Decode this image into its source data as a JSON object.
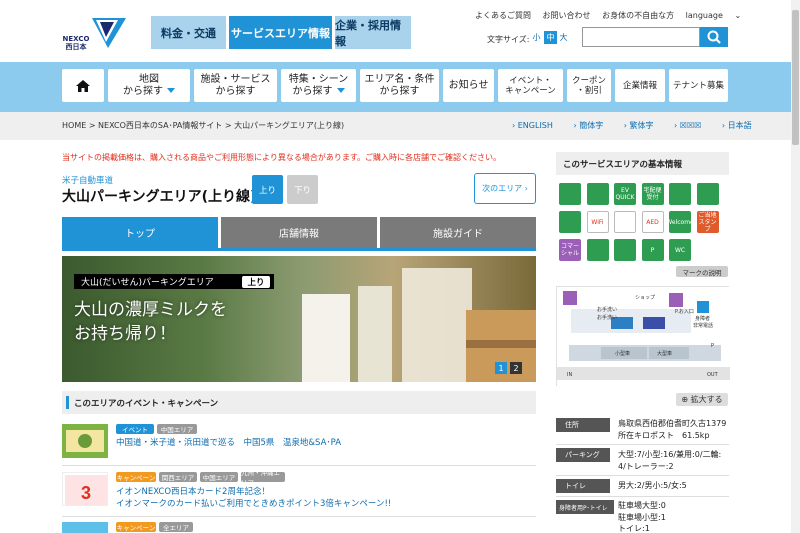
{
  "header": {
    "logo_text": "NEXCO\n西日本",
    "tabs": [
      {
        "label": "料金・交通"
      },
      {
        "label": "サービスエリア情報"
      },
      {
        "label": "企業・採用情報"
      }
    ],
    "util_links": [
      "よくあるご質問",
      "お問い合わせ",
      "お身体の不自由な方",
      "language"
    ],
    "font_size": {
      "label": "文字サイズ:",
      "small": "小",
      "medium": "中",
      "large": "大"
    },
    "search": {
      "value": "",
      "placeholder": ""
    }
  },
  "nav": {
    "items": [
      {
        "label": "地図",
        "sub": "から探す"
      },
      {
        "label": "施設・サービス",
        "sub": "から探す"
      },
      {
        "label": "特集・シーン",
        "sub": "から探す"
      },
      {
        "label": "エリア名・条件",
        "sub": "から探す"
      },
      {
        "label": "お知らせ"
      },
      {
        "label": "イベント・",
        "sub": "キャンペーン"
      },
      {
        "label": "クーポン",
        "sub": "・割引"
      },
      {
        "label": "企業情報"
      },
      {
        "label": "テナント募集"
      }
    ]
  },
  "breadcrumb": "HOME > NEXCO西日本のSA･PA情報サイト > 大山パーキングエリア(上り線)",
  "languages": [
    "ENGLISH",
    "簡体字",
    "繁体字",
    "☒☒☒",
    "日本語"
  ],
  "notice": "当サイトの掲載価格は、購入される商品やご利用形態により異なる場合があります。ご購入時に各店舗でご確認ください。",
  "area": {
    "route": "米子自動車道",
    "title": "大山パーキングエリア(上り線)",
    "up": "上り",
    "down": "下り",
    "next": "次のエリア"
  },
  "tabs": [
    "トップ",
    "店舗情報",
    "施設ガイド"
  ],
  "hero": {
    "caption": "大山(だいせん)パーキングエリア",
    "caption_dir": "上り",
    "headline_1": "大山の濃厚ミルクを",
    "headline_2": "お持ち帰り！",
    "pages": [
      "1",
      "2"
    ]
  },
  "events": {
    "heading": "このエリアのイベント・キャンペーン",
    "items": [
      {
        "badges": [
          "イベント",
          "中国エリア"
        ],
        "title": "中国道・米子道・浜田道で巡る　中国5県　温泉地&SA･PA"
      },
      {
        "badges": [
          "キャンペーン",
          "関西エリア",
          "中国エリア",
          "九州・沖縄エリア"
        ],
        "title": "イオンNEXCO西日本カード2周年記念！",
        "title2": "イオンマークのカード払いご利用でときめきポイント3倍キャンペーン!!"
      },
      {
        "badges": [
          "キャンペーン",
          "全エリア"
        ],
        "title": ""
      }
    ]
  },
  "side": {
    "heading": "このサービスエリアの基本情報",
    "legend": "マークの説明",
    "zoom": "拡大する",
    "map_labels": [
      "お手洗い",
      "お手洗い",
      "ショップ",
      "P.お入口",
      "身障者",
      "非常電話",
      "小型車",
      "大型車",
      "IN",
      "OUT",
      "P"
    ],
    "info": [
      {
        "label": "住所",
        "value": "鳥取県西伯郡伯耆町久古1379",
        "value2": "所在キロポスト　61.5kp"
      },
      {
        "label": "パーキング",
        "value": "大型:7/小型:16/兼用:0/二輪:",
        "value2": "4/トレーラー:2"
      },
      {
        "label": "トイレ",
        "value": "男大:2/男小:5/女:5"
      },
      {
        "label": "身障者用P･トイレ",
        "value": "駐車場大型:0",
        "value2": "駐車場小型:1",
        "value3": "トイレ:1"
      }
    ],
    "facilities": [
      "",
      "",
      "EV QUICK",
      "宅配便受付",
      "",
      "",
      "",
      "WiFi",
      "",
      "AED",
      "Welcome",
      "ご当地スタンプ",
      "コマーシャル",
      "",
      "",
      "P",
      "WC"
    ]
  },
  "colors": {
    "brand": "#1f93d6",
    "nav_bg": "#8dcbee",
    "tab_light": "#a9d2ec",
    "notice": "#e0301e",
    "facility_green": "#2e9d52"
  }
}
